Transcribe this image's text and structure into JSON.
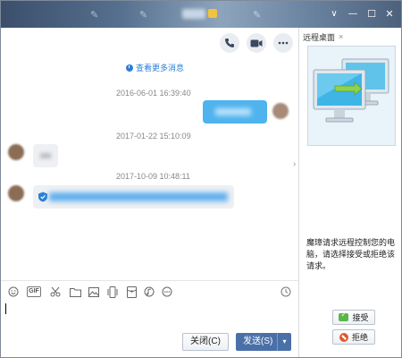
{
  "window": {
    "controls": {
      "dropdown": "∨",
      "minimize": "—",
      "maximize": "☐",
      "close": "✕"
    }
  },
  "chat": {
    "load_more": "查看更多消息",
    "messages": [
      {
        "time": "2016-06-01 16:39:40",
        "side": "right",
        "kind": "text"
      },
      {
        "time": "2017-01-22 15:10:09",
        "side": "left",
        "kind": "image"
      },
      {
        "time": "2017-10-09 10:48:11",
        "side": "left",
        "kind": "link"
      }
    ]
  },
  "icons": {
    "call": "phone-icon",
    "video": "video-icon",
    "more": "more-icon"
  },
  "toolbar": {
    "gif_label": "GIF"
  },
  "footer": {
    "close_label": "关闭(C)",
    "send_label": "发送(S)",
    "send_arrow": "▾"
  },
  "side_panel": {
    "tab_label": "远程桌面",
    "tab_close": "×",
    "request_text": "魔璋请求远程控制您的电脑，请选择接受或拒绝该请求。",
    "accept_label": "接受",
    "reject_label": "拒绝"
  },
  "colors": {
    "accent": "#2d7fd6",
    "send_button": "#4a70a8",
    "bubble_mine": "#4fb3ee",
    "bubble_theirs": "#eef0f3"
  }
}
